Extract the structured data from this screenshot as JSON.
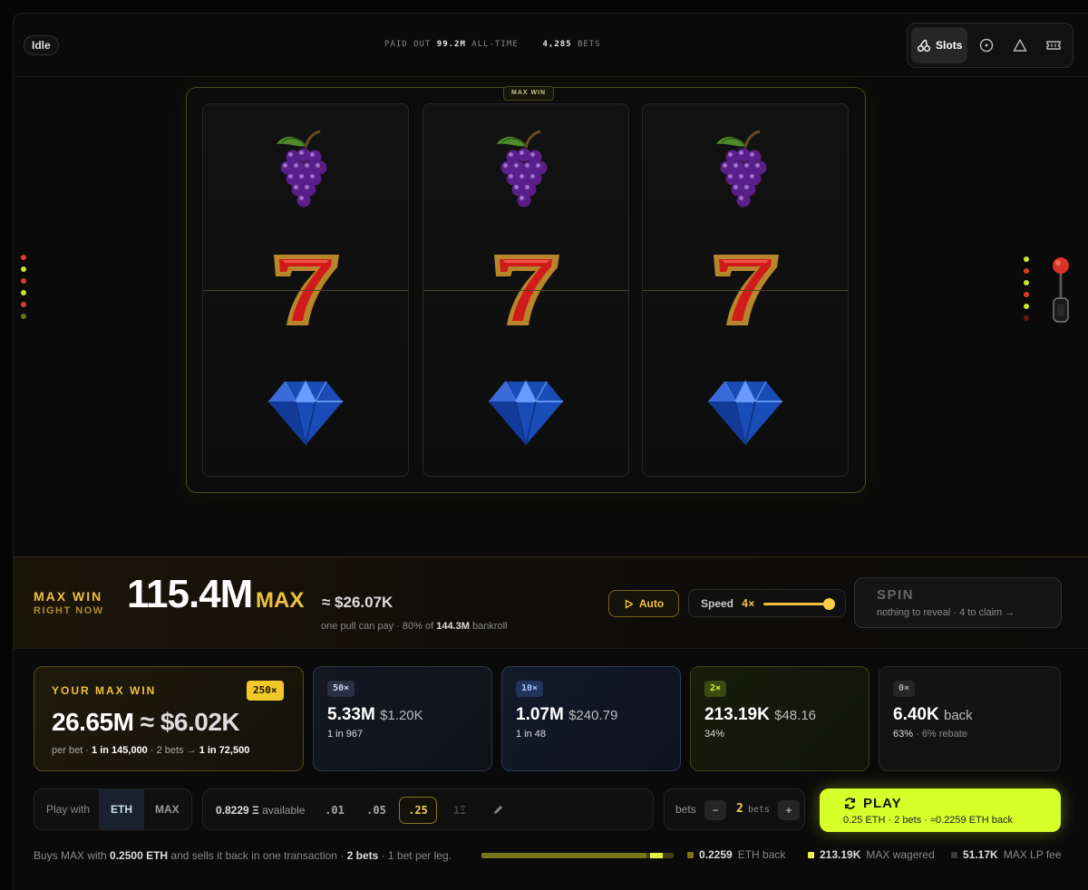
{
  "topbar": {
    "status": "Idle",
    "paid_out_label": "PAID OUT",
    "paid_out_value": "99.2M",
    "paid_out_suffix": "ALL-TIME",
    "bets_value": "4,285",
    "bets_label": "BETS"
  },
  "nav": {
    "slots_label": "Slots",
    "icons": [
      "cherries-icon",
      "roulette-icon",
      "triangle-icon",
      "ticket-icon"
    ]
  },
  "machine": {
    "tag": "MAX WIN",
    "reels": [
      [
        "grapes",
        "seven",
        "diamond"
      ],
      [
        "grapes",
        "seven",
        "diamond"
      ],
      [
        "grapes",
        "seven",
        "diamond"
      ]
    ]
  },
  "colors": {
    "accent_gold": "#f0c040",
    "accent_lime": "#d7ff29",
    "light_red": "#e23a2a",
    "light_lime": "#c8e62a"
  },
  "max_win": {
    "label": "MAX WIN",
    "sublabel": "RIGHT NOW",
    "amount": "115.4M",
    "unit": "MAX",
    "usd": "≈ $26.07K",
    "note_pre": "one pull can pay · 80% of",
    "note_bankroll": "144.3M",
    "note_post": "bankroll",
    "auto_label": "Auto",
    "speed_label": "Speed",
    "speed_value": "4×",
    "speed_level": 1.0,
    "spin_label": "SPIN",
    "spin_sub": "nothing to reveal · 4 to claim →"
  },
  "your_max": {
    "label": "YOUR MAX WIN",
    "multiplier": "250×",
    "amount": "26.65M",
    "usd": "≈ $6.02K",
    "foot_pre": "per bet ·",
    "foot_odds": "1 in 145,000",
    "foot_mid": "· 2 bets →",
    "foot_combined": "1 in 72,500"
  },
  "tiers": [
    {
      "badge": "50×",
      "amount": "5.33M",
      "usd": "$1.20K",
      "odds": "1 in 967",
      "extra": ""
    },
    {
      "badge": "10×",
      "amount": "1.07M",
      "usd": "$240.79",
      "odds": "1 in 48",
      "extra": ""
    },
    {
      "badge": "2×",
      "amount": "213.19K",
      "usd": "$48.16",
      "odds": "34%",
      "extra": ""
    },
    {
      "badge": "0×",
      "amount": "6.40K",
      "usd": "back",
      "odds": "63%",
      "extra": "· 6% rebate"
    }
  ],
  "controls": {
    "play_with_label": "Play with",
    "currency_eth": "ETH",
    "currency_max": "MAX",
    "available_value": "0.8229 Ξ",
    "available_label": "available",
    "chips": [
      ".01",
      ".05",
      ".25",
      "1Ξ"
    ],
    "selected_chip": ".25",
    "bets_label": "bets",
    "minus": "−",
    "plus": "+",
    "bet_count": "2",
    "bet_unit": "bets",
    "play_label": "PLAY",
    "play_sub": "0.25 ETH · 2 bets · ≈0.2259 ETH back"
  },
  "footer": {
    "text_pre": "Buys MAX with",
    "eth_amount": "0.2500 ETH",
    "text_mid": "and sells it back in one transaction ·",
    "bets": "2 bets",
    "text_post": "· 1 bet per leg.",
    "meter_back_fraction": 0.86,
    "eth_back_value": "0.2259",
    "eth_back_label": "ETH back",
    "wagered_value": "213.19K",
    "wagered_label": "MAX wagered",
    "lp_fee_value": "51.17K",
    "lp_fee_label": "MAX LP fee"
  }
}
